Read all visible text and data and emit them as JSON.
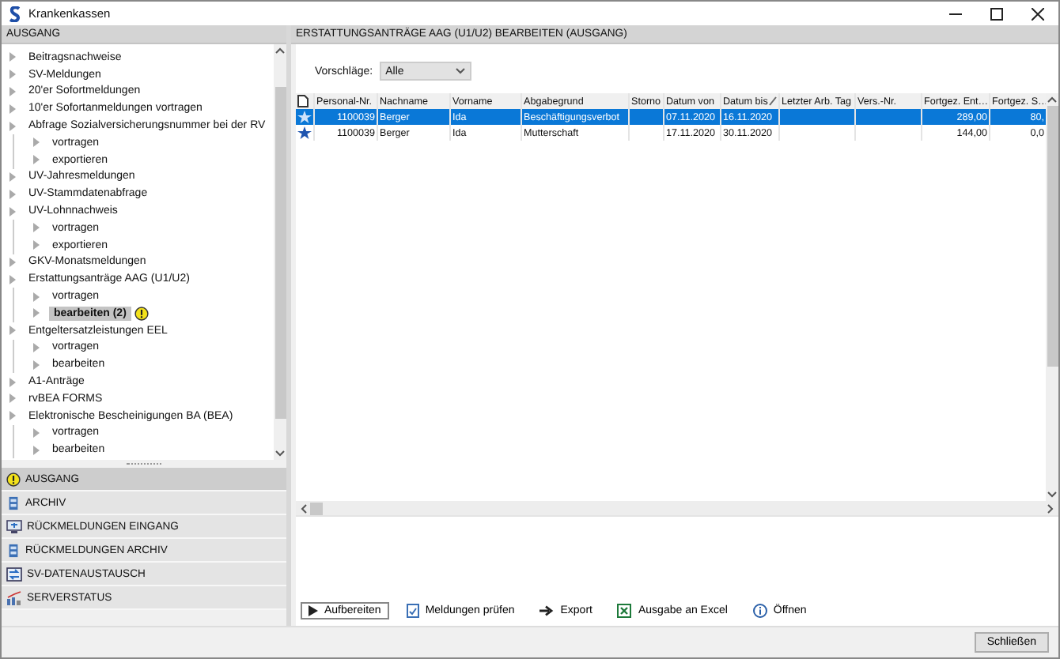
{
  "window": {
    "title": "Krankenkassen"
  },
  "left_header": "AUSGANG",
  "tree": [
    {
      "label": "Beitragsnachweise",
      "selected": false
    },
    {
      "label": "SV-Meldungen",
      "selected": false
    },
    {
      "label": "20'er Sofortmeldungen",
      "selected": false
    },
    {
      "label": "10'er Sofortanmeldungen vortragen",
      "selected": false
    },
    {
      "label": "Abfrage Sozialversicherungsnummer bei der RV",
      "selected": false,
      "children": [
        {
          "label": "vortragen",
          "selected": false
        },
        {
          "label": "exportieren",
          "selected": false
        }
      ]
    },
    {
      "label": "UV-Jahresmeldungen",
      "selected": false
    },
    {
      "label": "UV-Stammdatenabfrage",
      "selected": false
    },
    {
      "label": "UV-Lohnnachweis",
      "selected": false,
      "children": [
        {
          "label": "vortragen",
          "selected": false
        },
        {
          "label": "exportieren",
          "selected": false
        }
      ]
    },
    {
      "label": "GKV-Monatsmeldungen",
      "selected": false
    },
    {
      "label": "Erstattungsanträge AAG (U1/U2)",
      "selected": false,
      "children": [
        {
          "label": "vortragen",
          "selected": false
        },
        {
          "label": "bearbeiten (2)",
          "selected": true,
          "warning": true
        }
      ]
    },
    {
      "label": "Entgeltersatzleistungen EEL",
      "selected": false,
      "children": [
        {
          "label": "vortragen",
          "selected": false
        },
        {
          "label": "bearbeiten",
          "selected": false
        }
      ]
    },
    {
      "label": "A1-Anträge",
      "selected": false
    },
    {
      "label": "rvBEA FORMS",
      "selected": false
    },
    {
      "label": "Elektronische Bescheinigungen BA (BEA)",
      "selected": false,
      "children": [
        {
          "label": "vortragen",
          "selected": false
        },
        {
          "label": "bearbeiten",
          "selected": false
        }
      ]
    }
  ],
  "nav": [
    {
      "label": "AUSGANG",
      "kind": "warning",
      "selected": true
    },
    {
      "label": "ARCHIV",
      "kind": "archive",
      "selected": false
    },
    {
      "label": "RÜCKMELDUNGEN EINGANG",
      "kind": "inbox",
      "selected": false
    },
    {
      "label": "RÜCKMELDUNGEN ARCHIV",
      "kind": "archive",
      "selected": false
    },
    {
      "label": "SV-DATENAUSTAUSCH",
      "kind": "exchange",
      "selected": false
    },
    {
      "label": "SERVERSTATUS",
      "kind": "server",
      "selected": false
    }
  ],
  "panel_title": "ERSTATTUNGSANTRÄGE AAG (U1/U2) BEARBEITEN (AUSGANG)",
  "filter": {
    "label": "Vorschläge:",
    "value": "Alle"
  },
  "table": {
    "columns": [
      {
        "kind": "icon"
      },
      {
        "label": "Personal-Nr."
      },
      {
        "label": "Nachname"
      },
      {
        "label": "Vorname"
      },
      {
        "label": "Abgabegrund"
      },
      {
        "label": "Storno"
      },
      {
        "label": "Datum von"
      },
      {
        "label": "Datum bis",
        "sorted": true
      },
      {
        "label": "Letzter Arb. Tag"
      },
      {
        "label": "Vers.-Nr."
      },
      {
        "label": "Fortgez. Ent…"
      },
      {
        "label": "Fortgez. S…"
      }
    ],
    "rows": [
      {
        "selected": true,
        "cells": [
          "",
          "1100039",
          "Berger",
          "Ida",
          "Beschäftigungsverbot",
          "",
          "07.11.2020",
          "16.11.2020",
          "",
          "",
          "289,00",
          "80,"
        ]
      },
      {
        "selected": false,
        "cells": [
          "",
          "1100039",
          "Berger",
          "Ida",
          "Mutterschaft",
          "",
          "17.11.2020",
          "30.11.2020",
          "",
          "",
          "144,00",
          "0,0"
        ]
      }
    ]
  },
  "toolbar": [
    {
      "label": "Aufbereiten",
      "kind": "play"
    },
    {
      "label": "Meldungen prüfen",
      "kind": "check"
    },
    {
      "label": "Export",
      "kind": "arrow"
    },
    {
      "label": "Ausgabe an Excel",
      "kind": "excel"
    },
    {
      "label": "Öffnen",
      "kind": "info"
    }
  ],
  "close_button": "Schließen"
}
